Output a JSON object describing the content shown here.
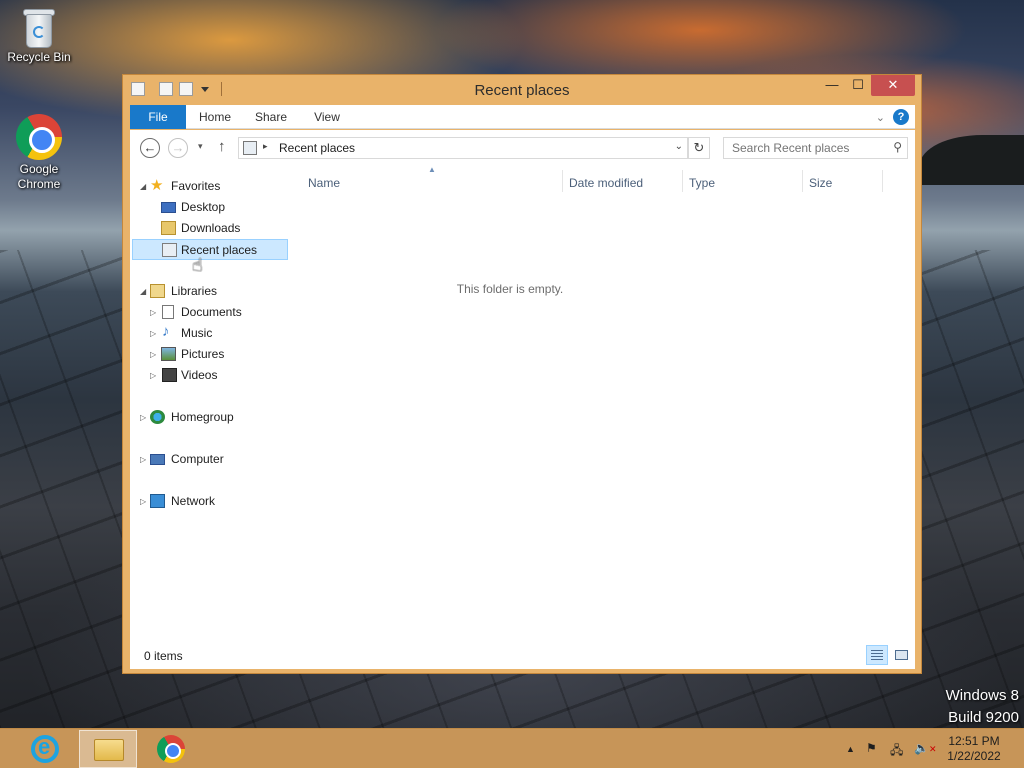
{
  "desktop": {
    "icons": [
      {
        "label": "Recycle Bin",
        "icon": "recycle-bin-icon"
      },
      {
        "label": "Google Chrome",
        "icon": "chrome-icon"
      }
    ],
    "watermark": {
      "line1": "Windows 8",
      "line2": "Build 9200"
    }
  },
  "window": {
    "title": "Recent places",
    "controls": {
      "minimize": "—",
      "maximize": "☐",
      "close": "✕"
    },
    "ribbon_tabs": [
      "File",
      "Home",
      "Share",
      "View"
    ],
    "ribbon_collapse": "⌄",
    "help": "?",
    "address": {
      "back": "←",
      "forward": "→",
      "recent": "▾",
      "up": "↑",
      "crumb": "Recent places",
      "crumb_sep": "▸",
      "dropdown": "⌄",
      "refresh": "↻",
      "search_placeholder": "Search Recent places",
      "search_icon": "⚲"
    },
    "nav": {
      "favorites": "Favorites",
      "desktop": "Desktop",
      "downloads": "Downloads",
      "recent_places": "Recent places",
      "libraries": "Libraries",
      "documents": "Documents",
      "music": "Music",
      "pictures": "Pictures",
      "videos": "Videos",
      "homegroup": "Homegroup",
      "computer": "Computer",
      "network": "Network",
      "expanded_glyph": "◢",
      "collapsed_glyph": "▷"
    },
    "columns": [
      "Name",
      "Date modified",
      "Type",
      "Size"
    ],
    "sort_caret": "▲",
    "empty_message": "This folder is empty.",
    "status": "0 items"
  },
  "taskbar": {
    "pinned": [
      "internet-explorer-icon",
      "file-explorer-icon",
      "chrome-icon"
    ],
    "tray": {
      "show_hidden": "▲",
      "flag": "⚑",
      "network": "🖧",
      "volume": "🔈",
      "volume_muted": "✕"
    },
    "clock": {
      "time": "12:51 PM",
      "date": "1/22/2022"
    }
  },
  "colors": {
    "window_frame": "#e9b36a",
    "file_tab": "#1979ca",
    "selection": "#cce8ff",
    "close_button": "#c75050",
    "taskbar": "#d6a05c"
  }
}
